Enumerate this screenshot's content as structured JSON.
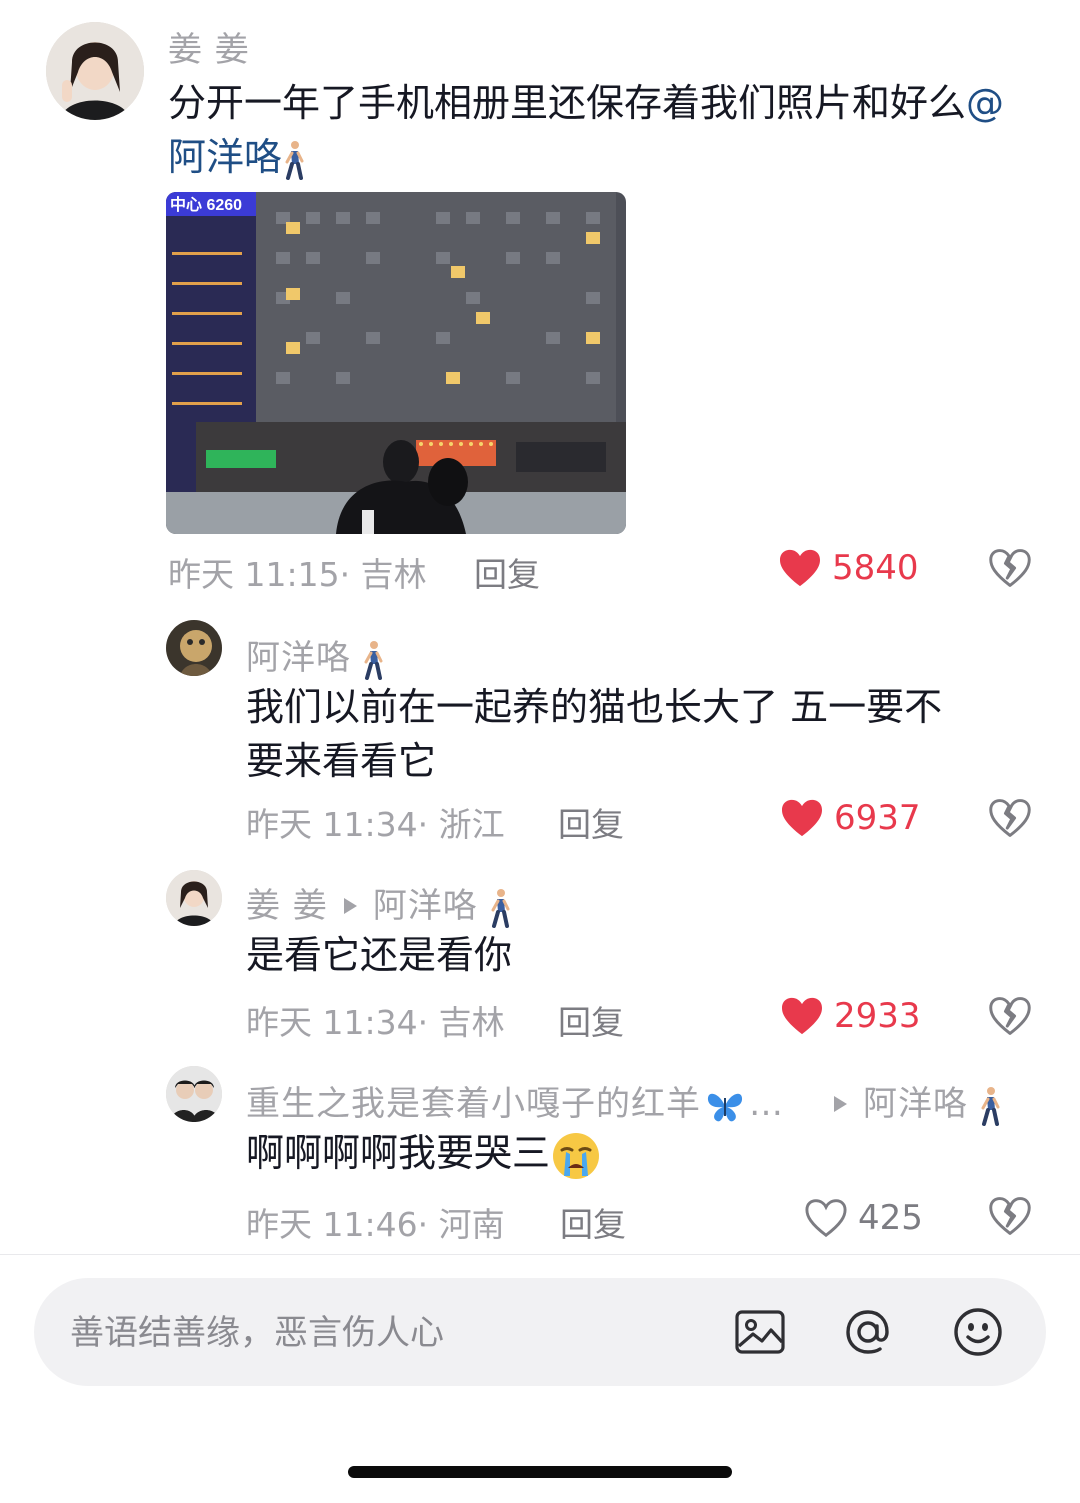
{
  "comments": [
    {
      "author": "姜 姜",
      "text": "分开一年了手机相册里还保存着我们照片和好么",
      "mention": "@阿洋咯",
      "time": "昨天 11:15",
      "location": "· 吉林",
      "reply_label": "回复",
      "likes": "5840",
      "liked": true
    }
  ],
  "replies": [
    {
      "author": "阿洋咯",
      "text_line1": "我们以前在一起养的猫也长大了 五一要不",
      "text_line2": "要来看看它",
      "time": "昨天 11:34",
      "location": "· 浙江",
      "reply_label": "回复",
      "likes": "6937",
      "liked": true
    },
    {
      "author": "姜 姜",
      "reply_to": "阿洋咯",
      "text": "是看它还是看你",
      "time": "昨天 11:34",
      "location": "· 吉林",
      "reply_label": "回复",
      "likes": "2933",
      "liked": true
    },
    {
      "author": "重生之我是套着小嘎子的红羊",
      "author_suffix": "…",
      "reply_to": "阿洋咯",
      "text": "啊啊啊啊我要哭三",
      "time": "昨天 11:46",
      "location": "· 河南",
      "reply_label": "回复",
      "likes": "425",
      "liked": false
    }
  ],
  "photo_sign_text": "中心 6260",
  "input": {
    "placeholder": "善语结善缘，恶言伤人心",
    "value": ""
  },
  "icons": [
    "image-icon",
    "at-icon",
    "emoji-icon",
    "heart-icon",
    "broken-heart-icon",
    "walking-person-icon",
    "butterfly-icon",
    "crying-face-icon"
  ],
  "colors": {
    "like_active": "#e8394c",
    "mention": "#1f4e85",
    "secondary_text": "#a3a3a8"
  }
}
